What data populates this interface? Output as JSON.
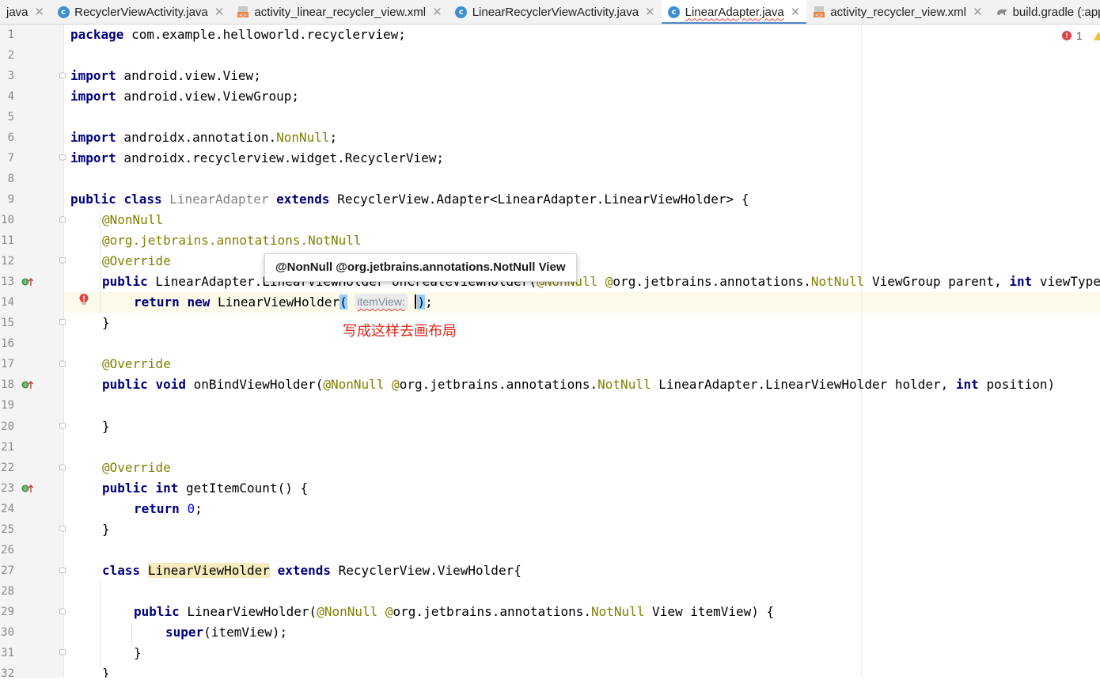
{
  "tabs": [
    {
      "label": "java",
      "icon": "none-icon",
      "closable": true,
      "active": false
    },
    {
      "label": "RecyclerViewActivity.java",
      "icon": "java-class-icon",
      "closable": true,
      "active": false
    },
    {
      "label": "activity_linear_recycler_view.xml",
      "icon": "xml-layout-icon",
      "closable": true,
      "active": false
    },
    {
      "label": "LinearRecyclerViewActivity.java",
      "icon": "java-class-icon",
      "closable": true,
      "active": false
    },
    {
      "label": "LinearAdapter.java",
      "icon": "java-class-icon",
      "closable": true,
      "active": true
    },
    {
      "label": "activity_recycler_view.xml",
      "icon": "xml-layout-icon",
      "closable": true,
      "active": false
    },
    {
      "label": "build.gradle (:app",
      "icon": "gradle-icon",
      "closable": false,
      "active": false
    }
  ],
  "inspection": {
    "error_count": "1"
  },
  "line_numbers": [
    "1",
    "2",
    "3",
    "4",
    "5",
    "6",
    "7",
    "8",
    "9",
    "10",
    "11",
    "12",
    "13",
    "14",
    "15",
    "16",
    "17",
    "18",
    "19",
    "20",
    "21",
    "22",
    "23",
    "24",
    "25",
    "26",
    "27",
    "28",
    "29",
    "30",
    "31",
    "32"
  ],
  "code": {
    "l1": {
      "kw": "package",
      "rest": " com.example.helloworld.recyclerview;"
    },
    "l3": {
      "kw": "import",
      "rest": " android.view.View;"
    },
    "l4": {
      "kw": "import",
      "rest": " android.view.ViewGroup;"
    },
    "l6": {
      "kw": "import",
      "rest": " androidx.annotation.",
      "ann": "NonNull",
      "end": ";"
    },
    "l7": {
      "kw": "import",
      "rest": " androidx.recyclerview.widget.RecyclerView;"
    },
    "l9": {
      "kw1": "public",
      "kw2": "class",
      "cls": "LinearAdapter",
      "kw3": "extends",
      "rest": " RecyclerView.Adapter<LinearAdapter.LinearViewHolder> {"
    },
    "l10": {
      "ann": "@NonNull"
    },
    "l11": {
      "pre": "@org.jetbrains.annotations.",
      "ann": "NotNull"
    },
    "l12": {
      "ann": "@Override"
    },
    "l13": {
      "kw": "public",
      "a": " LinearAdapter.LinearViewHolder onCreateViewHolder(",
      "ann1": "@NonNull",
      "b": " ",
      "ann2": "@",
      "c": "org.jetbrains.annotations.",
      "ann3": "NotNull",
      "d": " ViewGroup parent, ",
      "kw2": "int",
      "e": " viewType) {"
    },
    "l14": {
      "kw1": "return",
      "kw2": "new",
      "a": " LinearViewHolder",
      "paren_open": "(",
      "hint": "itemView:",
      "paren_close": ")",
      "end": ";"
    },
    "l15": {
      "text": "}"
    },
    "l17": {
      "ann": "@Override"
    },
    "l18": {
      "kw1": "public",
      "kw2": "void",
      "a": " onBindViewHolder(",
      "ann1": "@NonNull",
      "b": " ",
      "ann2": "@",
      "c": "org.jetbrains.annotations.",
      "ann3": "NotNull",
      "d": " LinearAdapter.LinearViewHolder holder, ",
      "kw3": "int",
      "e": " position)"
    },
    "l20": {
      "text": "}"
    },
    "l22": {
      "ann": "@Override"
    },
    "l23": {
      "kw1": "public",
      "kw2": "int",
      "a": " getItemCount() {"
    },
    "l24": {
      "kw": "return",
      "num": "0",
      "end": ";"
    },
    "l25": {
      "text": "}"
    },
    "l27": {
      "kw1": "class",
      "cls": "LinearViewHolder",
      "kw2": "extends",
      "a": " RecyclerView.ViewHolder{"
    },
    "l29": {
      "kw": "public",
      "a": " LinearViewHolder(",
      "ann1": "@NonNull",
      "b": " ",
      "ann2": "@",
      "c": "org.jetbrains.annotations.",
      "ann3": "NotNull",
      "d": " View itemView) {"
    },
    "l30": {
      "kw": "super",
      "a": "(itemView);"
    },
    "l31": {
      "text": "}"
    },
    "l32": {
      "text": "}"
    }
  },
  "tooltip": {
    "text": "@NonNull @org.jetbrains.annotations.NotNull View"
  },
  "annotation": {
    "text": "写成这样去画布局"
  },
  "colors": {
    "keyword": "#000080",
    "annotation": "#808000",
    "error": "#e04343",
    "accent": "#4a88c7",
    "note": "#e0261b"
  }
}
